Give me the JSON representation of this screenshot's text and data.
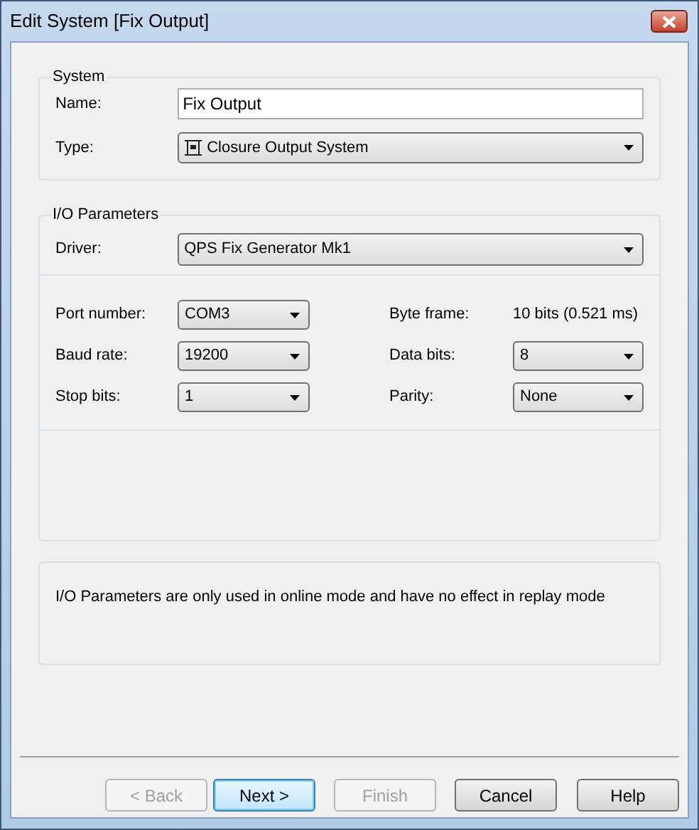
{
  "window": {
    "title": "Edit System [Fix Output]"
  },
  "system": {
    "title": "System",
    "name": {
      "label": "Name:",
      "value": "Fix Output"
    },
    "type": {
      "label": "Type:",
      "value": "Closure Output System"
    }
  },
  "io": {
    "title": "I/O Parameters",
    "driver": {
      "label": "Driver:",
      "value": "QPS Fix Generator Mk1"
    },
    "left": [
      {
        "label": "Port number:",
        "kind": "combo",
        "value": "COM3"
      },
      {
        "label": "Baud rate:",
        "kind": "combo",
        "value": "19200"
      },
      {
        "label": "Stop bits:",
        "kind": "combo",
        "value": "1"
      }
    ],
    "right": [
      {
        "label": "Byte frame:",
        "kind": "text",
        "value": "10 bits (0.521 ms)"
      },
      {
        "label": "Data bits:",
        "kind": "combo",
        "value": "8"
      },
      {
        "label": "Parity:",
        "kind": "combo",
        "value": "None"
      }
    ]
  },
  "note": "I/O Parameters are only used in online mode and have no effect in replay mode",
  "buttons": [
    {
      "label": "< Back",
      "disabled": true,
      "default": false
    },
    {
      "label": "Next >",
      "disabled": false,
      "default": true
    },
    {
      "label": "Finish",
      "disabled": true,
      "default": false
    },
    {
      "label": "Cancel",
      "disabled": false,
      "default": false
    },
    {
      "label": "Help",
      "disabled": false,
      "default": false
    }
  ]
}
